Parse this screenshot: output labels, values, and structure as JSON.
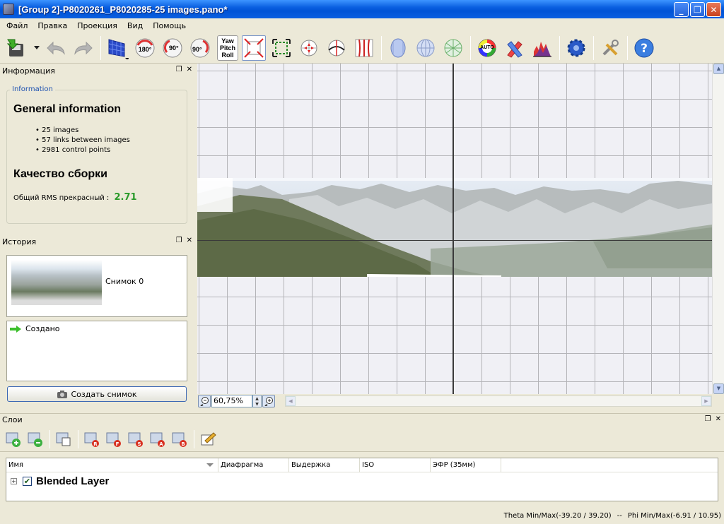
{
  "window": {
    "title": "[Group 2]-P8020261_P8020285-25 images.pano*",
    "buttons": [
      "_",
      "❐",
      "✕"
    ]
  },
  "menu": [
    "Файл",
    "Правка",
    "Проекция",
    "Вид",
    "Помощь"
  ],
  "toolbar": {
    "rotate_180": "180°",
    "rotate_90_ccw": "90°",
    "rotate_90_cw": "90°",
    "ypr": [
      "Yaw",
      "Pitch",
      "Roll"
    ],
    "auto_label": "AUTO"
  },
  "info_panel": {
    "header": "Информация",
    "legend": "Information",
    "general_title": "General information",
    "general_items": [
      "25 images",
      "57 links between images",
      "2981 control points"
    ],
    "quality_title": "Качество сборки",
    "rms_label": "Общий RMS прекрасный :",
    "rms_value": "2.71",
    "rms_color": "#2a9a2a"
  },
  "history_panel": {
    "header": "История",
    "snapshot_label": "Снимок 0",
    "history_item": "Создано",
    "create_snapshot_button": "Создать снимок"
  },
  "preview": {
    "zoom_value": "60,75%"
  },
  "layers_panel": {
    "header": "Слои",
    "columns": [
      "Имя",
      "Диафрагма",
      "Выдержка",
      "ISO",
      "ЭФР (35мм)"
    ],
    "rows": [
      {
        "name": "Blended Layer",
        "checked": true
      }
    ]
  },
  "status": {
    "theta": "Theta Min/Max(-39.20 / 39.20)",
    "sep": "--",
    "phi": "Phi Min/Max(-6.91 / 10.95)"
  }
}
